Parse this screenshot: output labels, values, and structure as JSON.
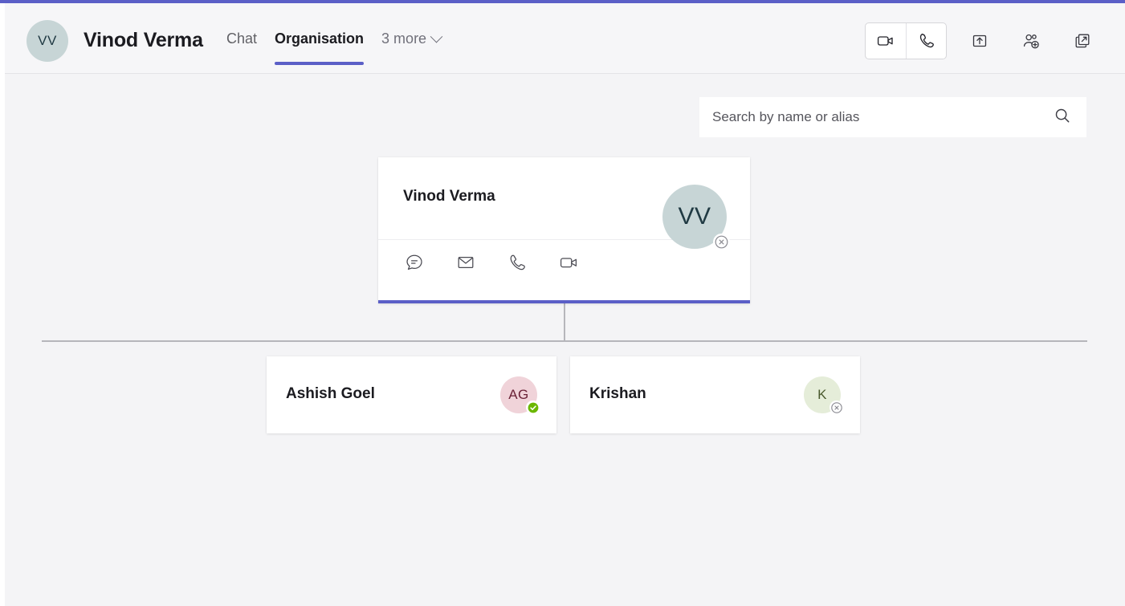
{
  "theme": {
    "accent": "#5b5fc7",
    "page_bg": "#f4f4f6",
    "card_bg": "#ffffff",
    "connector": "#b6b6bb",
    "text_primary": "#1b1b20",
    "text_secondary": "#616166",
    "status_available": "#6bb700",
    "status_offline": "#8a8a91"
  },
  "header": {
    "avatar_initials": "VV",
    "avatar_bg": "#c7d5d6",
    "avatar_fg": "#203a43",
    "title": "Vinod Verma",
    "tabs": [
      {
        "label": "Chat",
        "active": false
      },
      {
        "label": "Organisation",
        "active": true
      }
    ],
    "more_label": "3 more",
    "more_icon": "chevron-down-icon",
    "actions": [
      {
        "name": "video-call-icon",
        "label": "Video call"
      },
      {
        "name": "audio-call-icon",
        "label": "Audio call"
      },
      {
        "name": "share-icon",
        "label": "Share"
      },
      {
        "name": "add-people-icon",
        "label": "Add people"
      },
      {
        "name": "pop-out-icon",
        "label": "Pop out"
      }
    ]
  },
  "search": {
    "placeholder": "Search by name or alias",
    "value": "",
    "icon": "search-icon"
  },
  "org_chart": {
    "root": {
      "name": "Vinod Verma",
      "initials": "VV",
      "avatar_bg": "#c7d5d6",
      "avatar_fg": "#203a43",
      "presence": "offline",
      "presence_icon": "offline-x-icon",
      "selected": true,
      "actions": [
        {
          "name": "chat-icon",
          "label": "Chat"
        },
        {
          "name": "email-icon",
          "label": "Email"
        },
        {
          "name": "call-icon",
          "label": "Call"
        },
        {
          "name": "video-icon",
          "label": "Video call"
        }
      ]
    },
    "reports": [
      {
        "name": "Ashish Goel",
        "initials": "AG",
        "avatar_bg": "#f0d3d9",
        "avatar_fg": "#6b2237",
        "presence": "available",
        "presence_icon": "available-check-icon"
      },
      {
        "name": "Krishan",
        "initials": "K",
        "avatar_bg": "#e5edd9",
        "avatar_fg": "#4a5a2e",
        "presence": "offline",
        "presence_icon": "offline-x-icon"
      }
    ]
  }
}
